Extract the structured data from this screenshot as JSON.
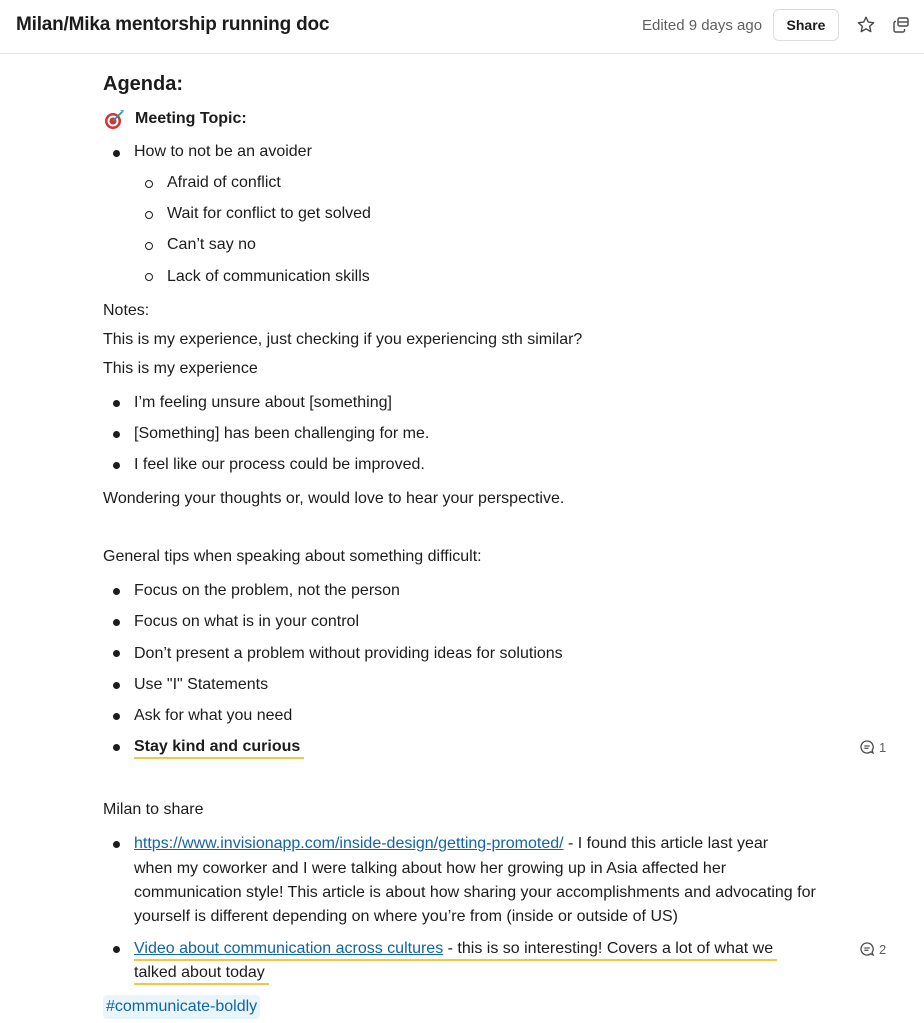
{
  "header": {
    "title": "Milan/Mika mentorship running doc",
    "edited": "Edited 9 days ago",
    "share_label": "Share",
    "icons": [
      "star-icon",
      "open-in-window-icon"
    ]
  },
  "agenda": {
    "heading": "Agenda:",
    "topic_icon": "direct-hit-target-emoji",
    "topic_label": "Meeting Topic:",
    "main_item": "How to not be an avoider",
    "sub_items": [
      "Afraid of conflict",
      "Wait for conflict to get solved",
      "Can’t say no",
      "Lack of communication skills"
    ]
  },
  "notes": {
    "label": "Notes:",
    "line1": "This is my experience, just checking if you experiencing sth similar?",
    "line2": "This is my experience",
    "items": [
      "I’m feeling unsure about [something]",
      "[Something] has been challenging for me.",
      "I feel like our process could be improved."
    ],
    "closing": "Wondering your thoughts or, would love to hear your perspective."
  },
  "tips": {
    "label": "General tips when speaking about something difficult:",
    "items": [
      "Focus on the problem, not the person",
      "Focus on what is in your control",
      "Don’t present a problem without providing ideas for solutions",
      "Use \"I\" Statements",
      "Ask for what you need",
      "Stay kind and curious"
    ],
    "comment_count": "1"
  },
  "share": {
    "label": "Milan to share",
    "item1": {
      "link": "https://www.invisionapp.com/inside-design/getting-promoted/",
      "text_line1": " - I found this article last year",
      "text_line2": "when my coworker and I were talking about how her growing up in Asia affected her",
      "text_line3": "communication style! This article is about how sharing your accomplishments and advocating for",
      "text_line4": "yourself is different depending on where you’re from (inside or outside of US)"
    },
    "item2": {
      "link": "Video about communication across cultures",
      "text_line1": " - this is so interesting! Covers a lot of what we",
      "text_line2": "talked about today",
      "comment_count": "2"
    }
  },
  "channel_tag": "#communicate-boldly",
  "colors": {
    "link": "#1264a3",
    "comment_highlight": "#f2c744",
    "channel_bg": "#e8f5fa",
    "text": "#1d1c1d",
    "muted": "#616061"
  }
}
